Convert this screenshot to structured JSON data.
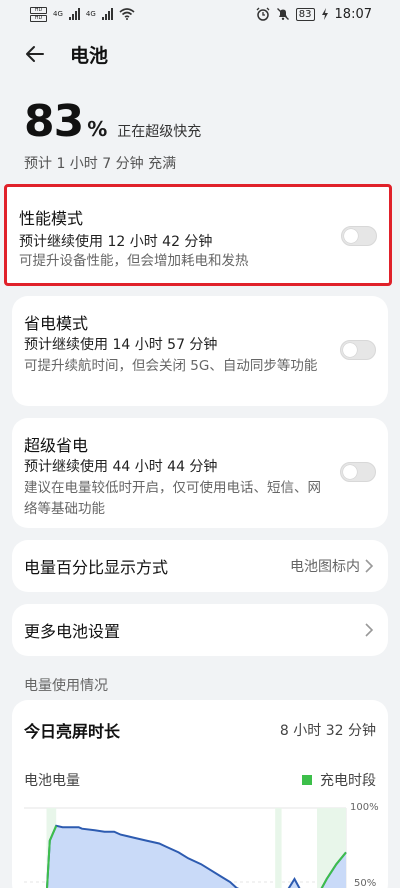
{
  "status_bar": {
    "time": "18:07",
    "battery": "83",
    "net1": "4G",
    "net2": "4G"
  },
  "header": {
    "title": "电池"
  },
  "summary": {
    "percent": "83",
    "percent_sign": "%",
    "state": "正在超级快充",
    "estimate": "预计 1 小时 7 分钟 充满"
  },
  "modes": [
    {
      "title": "性能模式",
      "usage": "预计继续使用 12 小时 42 分钟",
      "desc": "可提升设备性能，但会增加耗电和发热",
      "enabled": false
    },
    {
      "title": "省电模式",
      "usage": "预计继续使用 14 小时 57 分钟",
      "desc": "可提升续航时间，但会关闭 5G、自动同步等功能",
      "enabled": false
    },
    {
      "title": "超级省电",
      "usage": "预计继续使用 44 小时 44 分钟",
      "desc": "建议在电量较低时开启，仅可使用电话、短信、网络等基础功能",
      "enabled": false
    }
  ],
  "rows": {
    "percent_display": {
      "label": "电量百分比显示方式",
      "value": "电池图标内"
    },
    "more_settings": {
      "label": "更多电池设置"
    }
  },
  "usage": {
    "section_label": "电量使用情况",
    "screen_time_label": "今日亮屏时长",
    "screen_time_value": "8 小时 32 分钟",
    "chart_title": "电池电量",
    "legend_label": "充电时段",
    "legend_color": "#3dbf4a",
    "tick_top": "100%",
    "tick_mid": "50%"
  },
  "chart_data": {
    "type": "area",
    "title": "电池电量",
    "y_ticks": [
      "100%",
      "50%"
    ],
    "ylim": [
      0,
      100
    ],
    "x": [
      0,
      4,
      7,
      8,
      10,
      12,
      17,
      18,
      22,
      25,
      28,
      30,
      34,
      38,
      42,
      44,
      48,
      51,
      55,
      58,
      61,
      64,
      66,
      70,
      73,
      76,
      78,
      80,
      84,
      87,
      90,
      91,
      94,
      97,
      100
    ],
    "values": [
      38,
      40,
      40,
      78,
      88,
      87,
      87,
      86,
      85,
      84,
      84,
      82,
      80,
      78,
      76,
      74,
      70,
      66,
      62,
      58,
      54,
      50,
      46,
      42,
      38,
      35,
      32,
      38,
      52,
      40,
      30,
      40,
      52,
      62,
      70
    ],
    "charging_ranges": [
      [
        7,
        10
      ],
      [
        78,
        80
      ],
      [
        91,
        100
      ]
    ],
    "colors": {
      "line": "#2d5bb0",
      "fill": "#c9daf8",
      "charging": "#3dbf4a"
    }
  }
}
